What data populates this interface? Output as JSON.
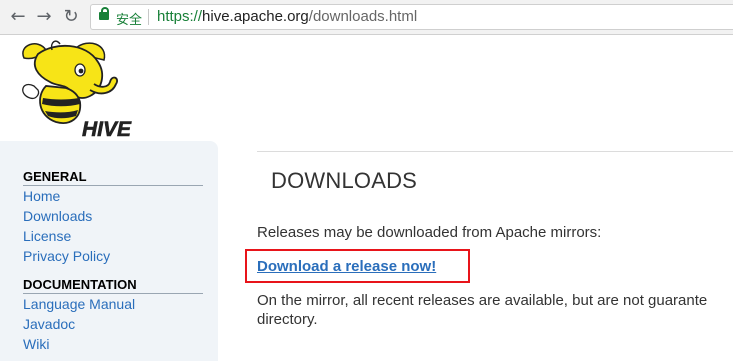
{
  "browser": {
    "back_icon": "back-arrow-icon",
    "forward_icon": "forward-arrow-icon",
    "reload_icon": "reload-icon",
    "secure_label": "安全",
    "url_scheme": "https://",
    "url_host": "hive.apache.org",
    "url_path": "/downloads.html"
  },
  "logo": {
    "text": "HIVE"
  },
  "sidebar": {
    "general_title": "GENERAL",
    "general_items": [
      "Home",
      "Downloads",
      "License",
      "Privacy Policy"
    ],
    "documentation_title": "DOCUMENTATION",
    "documentation_items": [
      "Language Manual",
      "Javadoc",
      "Wiki"
    ]
  },
  "main": {
    "title": "DOWNLOADS",
    "intro": "Releases may be downloaded from Apache mirrors:",
    "download_link": "Download a release now!",
    "mirror_line1": "On the mirror, all recent releases are available, but are not guarante",
    "mirror_line2": "directory."
  },
  "colors": {
    "link": "#2a6ebb",
    "highlight": "#e8141a",
    "secure": "#188038"
  }
}
